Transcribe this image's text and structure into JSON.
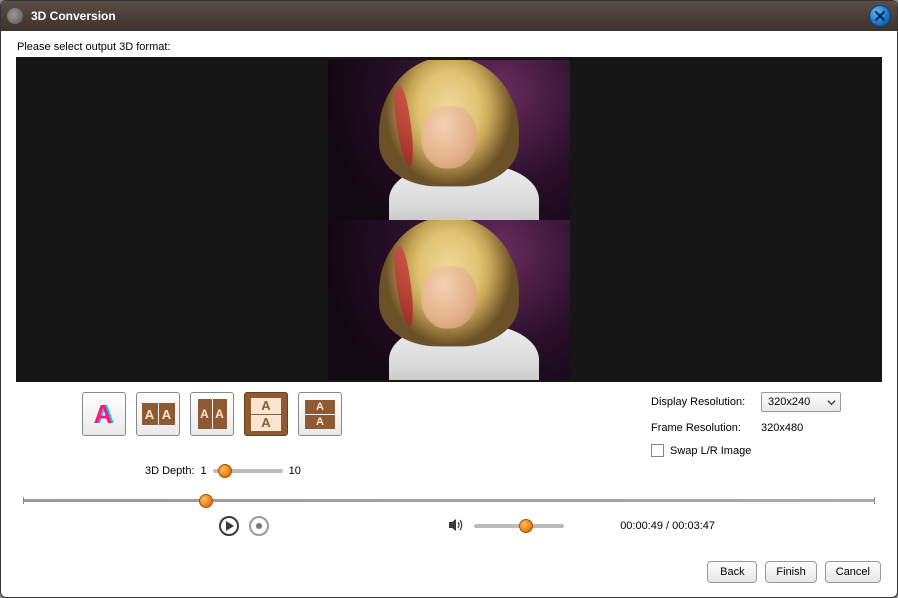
{
  "window": {
    "title": "3D Conversion"
  },
  "instruction": "Please select output 3D format:",
  "formats": {
    "anaglyph_glyph": "A",
    "sbs_half_a": "A",
    "sbs_full_a": "A",
    "tb_half_a": "A",
    "tb_full_a": "A"
  },
  "depth": {
    "label": "3D Depth:",
    "min": "1",
    "max": "10",
    "value_pct": 18
  },
  "display_resolution": {
    "label": "Display Resolution:",
    "value": "320x240"
  },
  "frame_resolution": {
    "label": "Frame Resolution:",
    "value": "320x480"
  },
  "swap": {
    "label": "Swap L/R Image",
    "checked": false
  },
  "timeline": {
    "pos_pct": 21.5
  },
  "volume": {
    "pos_pct": 58
  },
  "time": {
    "display": "00:00:49 / 00:03:47"
  },
  "buttons": {
    "back": "Back",
    "finish": "Finish",
    "cancel": "Cancel"
  }
}
